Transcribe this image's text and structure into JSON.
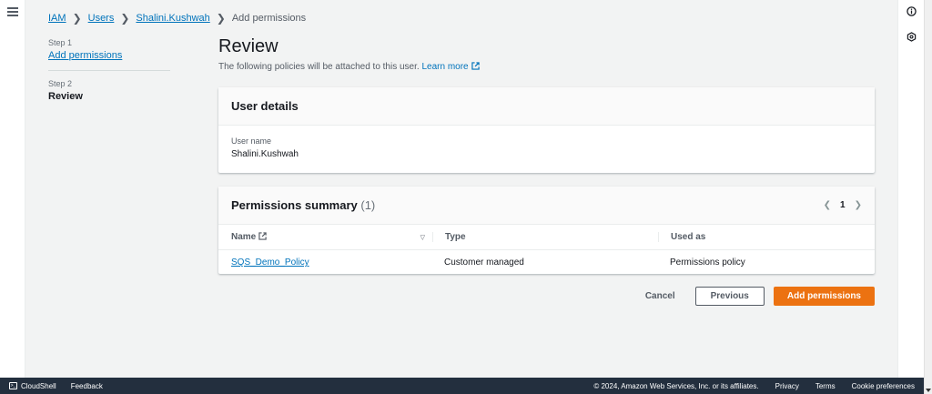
{
  "breadcrumb": [
    {
      "label": "IAM"
    },
    {
      "label": "Users"
    },
    {
      "label": "Shalini.Kushwah"
    },
    {
      "label": "Add permissions"
    }
  ],
  "steps": {
    "step1_label": "Step 1",
    "step1_link": "Add permissions",
    "step2_label": "Step 2",
    "step2_current": "Review"
  },
  "header": {
    "title": "Review",
    "subtitle": "The following policies will be attached to this user.",
    "learn_more": "Learn more"
  },
  "user_details": {
    "title": "User details",
    "user_name_label": "User name",
    "user_name_value": "Shalini.Kushwah"
  },
  "permissions_summary": {
    "title": "Permissions summary",
    "count": "(1)",
    "page": "1",
    "columns": {
      "name": "Name",
      "type": "Type",
      "used_as": "Used as"
    },
    "rows": [
      {
        "name": "SQS_Demo_Policy",
        "type": "Customer managed",
        "used_as": "Permissions policy"
      }
    ]
  },
  "actions": {
    "cancel": "Cancel",
    "previous": "Previous",
    "add": "Add permissions"
  },
  "footer": {
    "cloudshell": "CloudShell",
    "feedback": "Feedback",
    "copyright": "© 2024, Amazon Web Services, Inc. or its affiliates.",
    "privacy": "Privacy",
    "terms": "Terms",
    "cookies": "Cookie preferences"
  },
  "colors": {
    "link": "#0073bb",
    "primary": "#ec7211",
    "footer_bg": "#232f3e"
  }
}
